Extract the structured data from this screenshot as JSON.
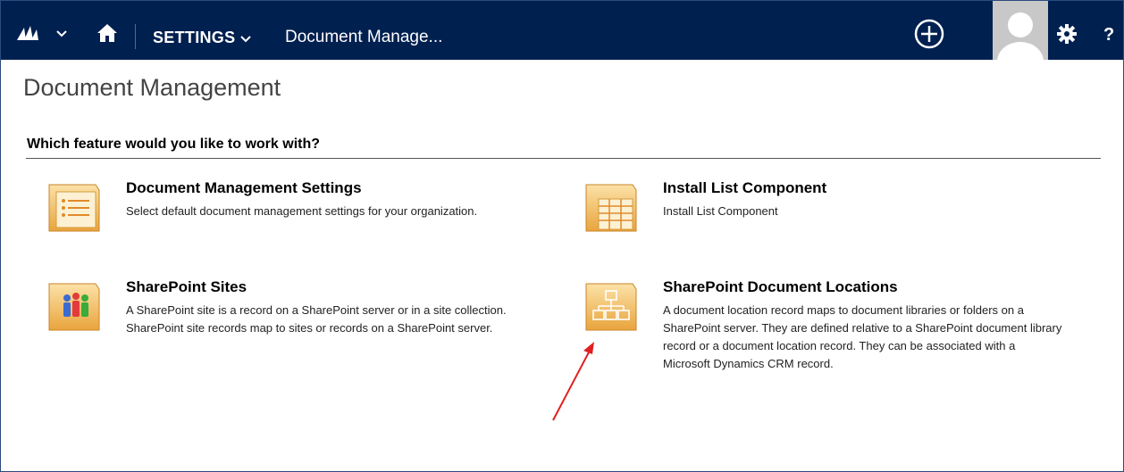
{
  "navbar": {
    "section_label": "SETTINGS",
    "breadcrumb": "Document Manage...",
    "help_label": "?",
    "background_color": "#002050"
  },
  "page": {
    "title": "Document Management",
    "question": "Which feature would you like to work with?"
  },
  "features": [
    {
      "icon": "list-settings-icon",
      "title": "Document Management Settings",
      "description": "Select default document management settings for your organization."
    },
    {
      "icon": "table-grid-icon",
      "title": "Install List Component",
      "description": "Install List Component"
    },
    {
      "icon": "people-group-icon",
      "title": "SharePoint Sites",
      "description": "A SharePoint site is a record on a SharePoint server or in a site collection. SharePoint site records map to sites or records on a SharePoint server."
    },
    {
      "icon": "hierarchy-icon",
      "title": "SharePoint Document Locations",
      "description": "A document location record maps to document libraries or folders on a SharePoint server. They are defined relative to a SharePoint document library record or a document location record. They can be associated with a Microsoft Dynamics CRM record."
    }
  ],
  "annotation": {
    "arrow_color": "#e02020",
    "arrow_target": "SharePoint Document Locations"
  }
}
